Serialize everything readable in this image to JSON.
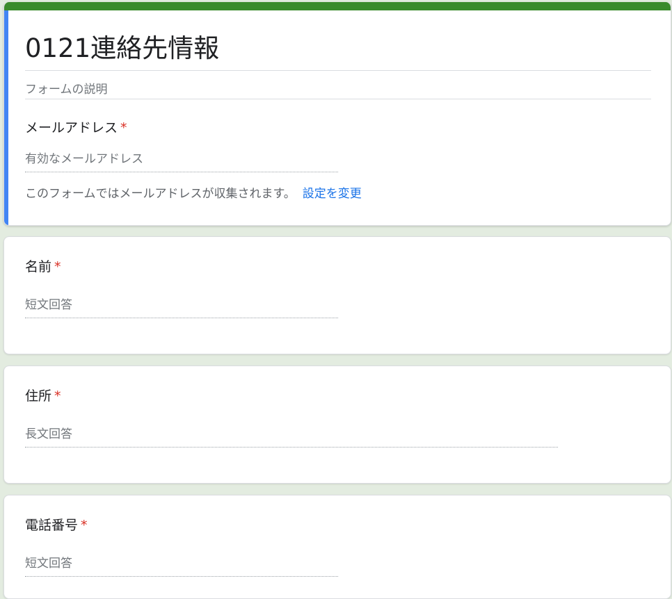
{
  "form": {
    "title": "0121連絡先情報",
    "description": "フォームの説明",
    "colors": {
      "top_bar": "#3a8b2c",
      "accent": "#4285f4",
      "required": "#d93025",
      "link": "#1a73e8",
      "background": "#e3ece0"
    }
  },
  "email_section": {
    "label": "メールアドレス",
    "required_mark": "*",
    "placeholder": "有効なメールアドレス",
    "note": "このフォームではメールアドレスが収集されます。",
    "settings_link": "設定を変更"
  },
  "questions": [
    {
      "label": "名前",
      "required_mark": "*",
      "answer_placeholder": "短文回答"
    },
    {
      "label": "住所",
      "required_mark": "*",
      "answer_placeholder": "長文回答"
    },
    {
      "label": "電話番号",
      "required_mark": "*",
      "answer_placeholder": "短文回答"
    }
  ]
}
